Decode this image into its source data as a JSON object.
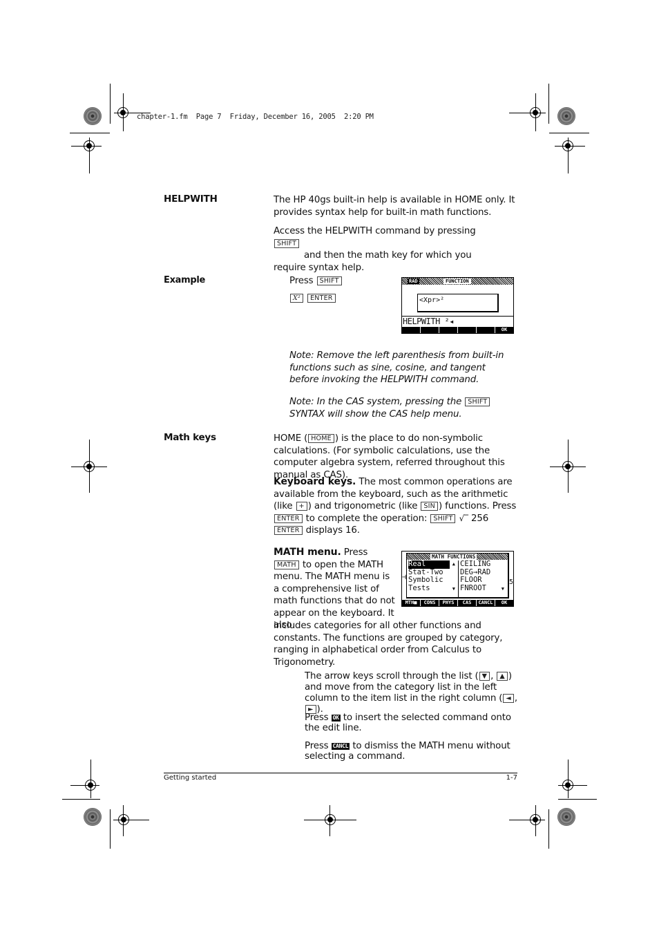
{
  "print_header": "chapter-1.fm  Page 7  Friday, December 16, 2005  2:20 PM",
  "sections": {
    "helpwith": {
      "heading": "HELPWITH",
      "para1": "The HP 40gs built-in help is available in HOME only. It provides syntax help for built-in math functions.",
      "para2_a": "Access the HELPWITH command by pressing",
      "para2_key": "SHIFT",
      "para2_b": "and then the math key for which you require syntax help."
    },
    "example": {
      "heading": "Example",
      "press": "Press",
      "keys": [
        "SHIFT",
        "X²",
        "ENTER"
      ],
      "screen": {
        "mode": "RAD",
        "title": "FUNCTION",
        "syntax": "<Xpr>²",
        "command_line": "HELPWITH ²◂",
        "softkeys": [
          "",
          "",
          "",
          "",
          "",
          "OK"
        ]
      },
      "note1": "Note: Remove the left parenthesis from built-in functions such as sine, cosine, and tangent before invoking the HELPWITH command.",
      "note2_a": "Note: In the CAS system, pressing the",
      "note2_key": "SHIFT",
      "note2_b": "SYNTAX will show the CAS help menu."
    },
    "math_keys": {
      "heading": "Math keys",
      "para1_a": "HOME (",
      "para1_key": "HOME",
      "para1_b": ") is the place to do non-symbolic calculations. (For symbolic calculations, use the computer algebra system, referred throughout this manual as CAS).",
      "kb_title": "Keyboard keys.",
      "kb_a": "The most common operations are available from the keyboard, such as the arithmetic (like",
      "kb_key_plus": "+",
      "kb_b": ") and trigonometric (like",
      "kb_key_sin": "SIN",
      "kb_c": ") functions. Press",
      "kb_key_enter": "ENTER",
      "kb_d": "to complete the operation:",
      "kb_key_shift": "SHIFT",
      "kb_sqrt": "√‾",
      "kb_num": "256",
      "kb_key_enter2": "ENTER",
      "kb_e": "displays 16.",
      "mm_title": "MATH menu.",
      "mm_a": "Press",
      "mm_key": "MATH",
      "mm_b": "to open the MATH menu. The MATH menu is a comprehensive list of math functions that do not appear on the keyboard. It also",
      "mm_c": "includes categories for all other functions and constants. The functions are grouped by category, ranging in alphabetical order from Calculus to Trigonometry.",
      "math_screen": {
        "title": "MATH FUNCTIONS",
        "categories": [
          "Real",
          "Stat-Two",
          "Symbolic",
          "Tests"
        ],
        "selected_category": "Real",
        "items": [
          "CEILING",
          "DEG→RAD",
          "FLOOR",
          "FNROOT"
        ],
        "softkeys": [
          "MTH■",
          "CONS",
          "PHYS",
          "CAS",
          "CANCL",
          "OK"
        ]
      },
      "arrows_a": "The arrow keys scroll through the list (",
      "arrow_down": "▼",
      "arrow_up": "▲",
      "arrows_b": ") and move from the category list in the left column to the item list in the right column (",
      "arrow_left": "◄",
      "arrow_right": "►",
      "arrows_c": ").",
      "ok_a": "Press",
      "ok_key": "OK",
      "ok_b": "to insert the selected command onto the edit line.",
      "cancel_a": "Press",
      "cancel_key": "CANCL",
      "cancel_b": "to dismiss the MATH menu without selecting a command."
    }
  },
  "footer": {
    "left": "Getting started",
    "right": "1-7"
  }
}
